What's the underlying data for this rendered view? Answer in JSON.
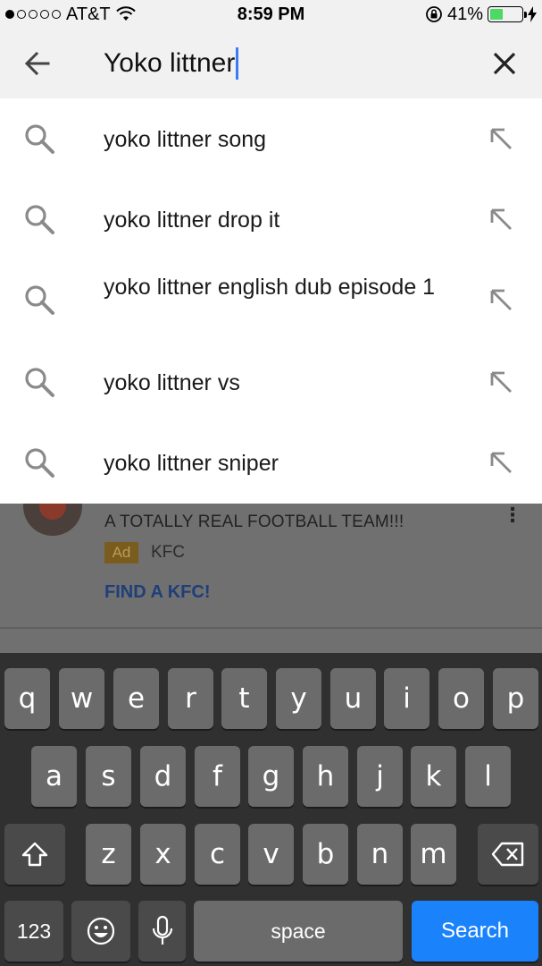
{
  "status_bar": {
    "carrier": "AT&T",
    "time": "8:59 PM",
    "battery": "41%",
    "battery_level": 0.41,
    "signal_bars": 1
  },
  "search": {
    "query": "Yoko littner"
  },
  "suggestions": [
    {
      "text": "yoko littner song"
    },
    {
      "text": "yoko littner drop it"
    },
    {
      "text": "yoko littner english dub episode 1"
    },
    {
      "text": "yoko littner vs"
    },
    {
      "text": "yoko littner sniper"
    }
  ],
  "background_ad": {
    "title": "A TOTALLY REAL FOOTBALL TEAM!!!",
    "badge": "Ad",
    "advertiser": "KFC",
    "cta": "FIND A KFC!"
  },
  "keyboard": {
    "row1": [
      "q",
      "w",
      "e",
      "r",
      "t",
      "y",
      "u",
      "i",
      "o",
      "p"
    ],
    "row2": [
      "a",
      "s",
      "d",
      "f",
      "g",
      "h",
      "j",
      "k",
      "l"
    ],
    "row3": [
      "z",
      "x",
      "c",
      "v",
      "b",
      "n",
      "m"
    ],
    "numbers_label": "123",
    "space_label": "space",
    "search_label": "Search"
  },
  "colors": {
    "accent": "#1a82fb",
    "caret": "#3b7df0",
    "battery_fill": "#4cd964"
  }
}
